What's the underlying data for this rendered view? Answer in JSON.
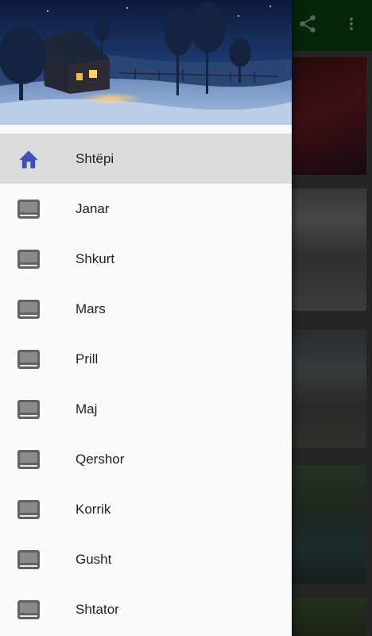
{
  "drawer": {
    "header_icon": "night-village-scene-image",
    "items": [
      {
        "label": "Shtëpi",
        "icon": "home-icon",
        "active": true
      },
      {
        "label": "Janar",
        "icon": "tray-icon"
      },
      {
        "label": "Shkurt",
        "icon": "tray-icon"
      },
      {
        "label": "Mars",
        "icon": "tray-icon"
      },
      {
        "label": "Prill",
        "icon": "tray-icon"
      },
      {
        "label": "Maj",
        "icon": "tray-icon"
      },
      {
        "label": "Qershor",
        "icon": "tray-icon"
      },
      {
        "label": "Korrik",
        "icon": "tray-icon"
      },
      {
        "label": "Gusht",
        "icon": "tray-icon"
      },
      {
        "label": "Shtator",
        "icon": "tray-icon"
      }
    ]
  },
  "toolbar": {
    "share_icon": "share-icon",
    "more_icon": "more-vert-icon"
  },
  "colors": {
    "accent": "#3f51b5",
    "toolbar": "#0b3a0b",
    "active_row": "#dcdcdc",
    "icon_gray": "#616161"
  }
}
